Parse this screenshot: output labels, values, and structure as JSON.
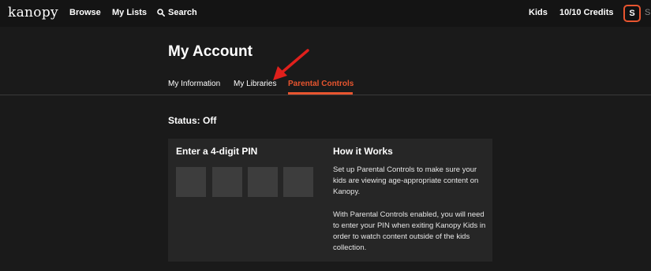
{
  "header": {
    "logo": "kanopy",
    "nav": {
      "browse": "Browse",
      "my_lists": "My Lists",
      "search": "Search"
    },
    "kids": "Kids",
    "credits": "10/10 Credits",
    "avatar_initial": "S",
    "avatar_trailing": "S"
  },
  "page": {
    "title": "My Account",
    "tabs": [
      {
        "label": "My Information",
        "active": false
      },
      {
        "label": "My Libraries",
        "active": false
      },
      {
        "label": "Parental Controls",
        "active": true
      }
    ],
    "accent_color": "#e8552f",
    "annotation": "red-arrow-pointing-to-my-libraries"
  },
  "parental_controls": {
    "status": "Status: Off",
    "pin_title": "Enter a 4-digit PIN",
    "pin_digits": [
      "",
      "",
      "",
      ""
    ],
    "how_title": "How it Works",
    "how_paragraph_1": "Set up Parental Controls to make sure your kids are viewing age-appropriate content on Kanopy.",
    "how_paragraph_2": "With Parental Controls enabled, you will need to enter your PIN when exiting Kanopy Kids in order to watch content outside of the kids collection."
  }
}
